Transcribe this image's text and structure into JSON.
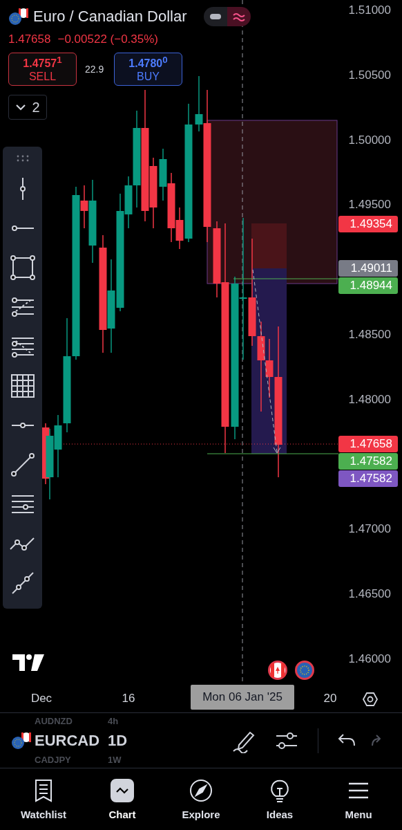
{
  "header": {
    "title": "Euro / Canadian Dollar",
    "price": "1.47658",
    "change": "−0.00522 (−0.35%)"
  },
  "sell": {
    "price": "1.4757$^{1}$",
    "label": "SELL"
  },
  "spread": "22.9",
  "buy": {
    "price": "1.4780$^{0}$",
    "label": "BUY"
  },
  "indicators": {
    "count": "2"
  },
  "price_axis": {
    "ticks": [
      "1.51000",
      "1.50500",
      "1.50000",
      "1.49500",
      "1.48500",
      "1.48000",
      "1.47000",
      "1.46500",
      "1.46000"
    ],
    "markers": [
      {
        "text": "1.49354",
        "color": "#f23645"
      },
      {
        "text": "1.49011",
        "color": "#787b86"
      },
      {
        "text": "1.48944",
        "color": "#4caf50"
      },
      {
        "text": "1.47658",
        "color": "#f23645"
      },
      {
        "text": "1.47582",
        "color": "#4caf50"
      },
      {
        "text": "1.47582",
        "color": "#7e57c2"
      }
    ]
  },
  "time_axis": {
    "labels": [
      "Dec",
      "16",
      "20"
    ],
    "crosshair_label": "Mon 06 Jan '25"
  },
  "symbol_picker": [
    {
      "symbol": "AUDNZD",
      "interval": "4h",
      "selected": false
    },
    {
      "symbol": "EURCAD",
      "interval": "1D",
      "selected": true
    },
    {
      "symbol": "CADJPY",
      "interval": "1W",
      "selected": false
    }
  ],
  "nav": [
    {
      "label": "Watchlist",
      "selected": false
    },
    {
      "label": "Chart",
      "selected": true
    },
    {
      "label": "Explore",
      "selected": false
    },
    {
      "label": "Ideas",
      "selected": false
    },
    {
      "label": "Menu",
      "selected": false
    }
  ]
}
